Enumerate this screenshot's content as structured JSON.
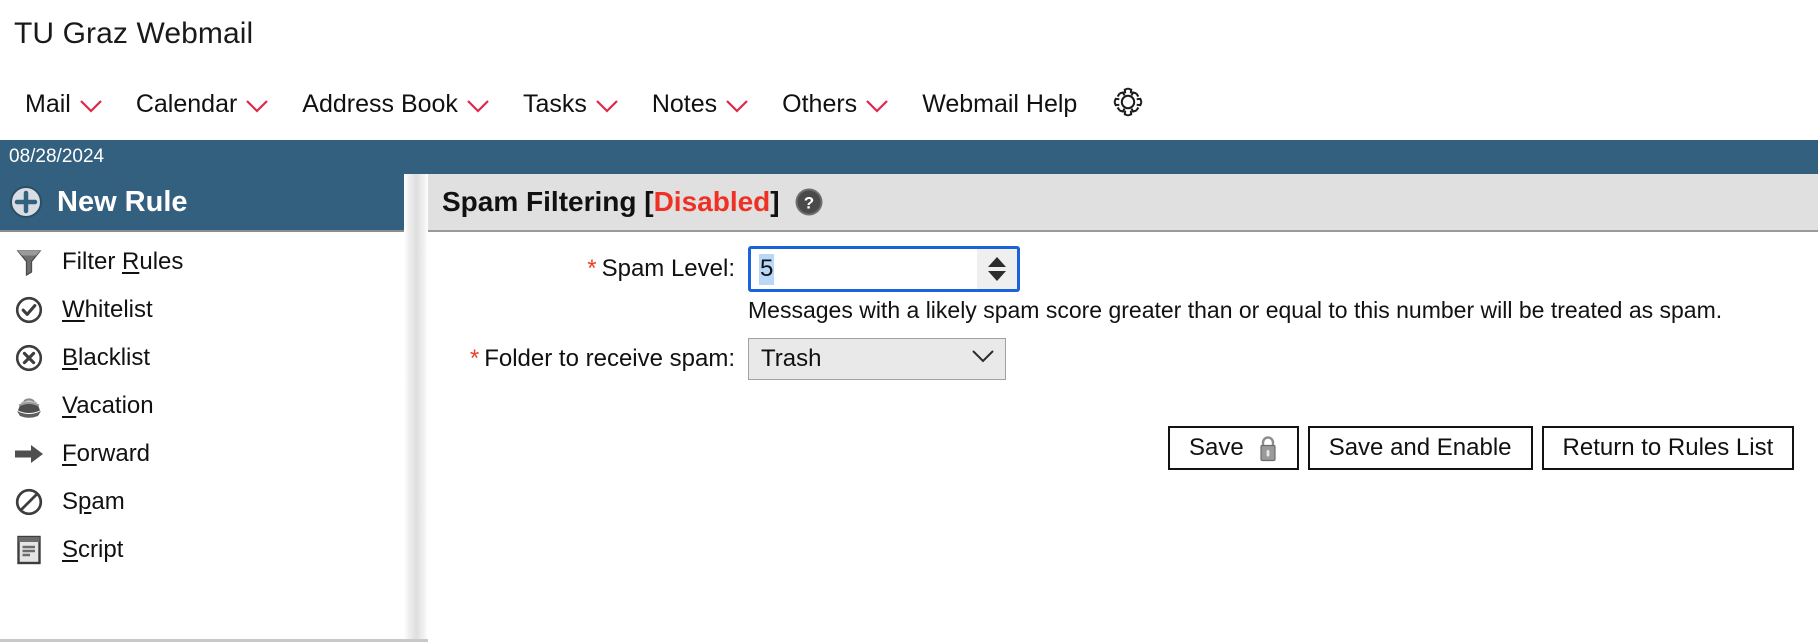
{
  "brand": {
    "title": "TU Graz Webmail"
  },
  "nav": {
    "items": [
      {
        "label": "Mail",
        "has_caret": true,
        "icon": "chevron-down-icon"
      },
      {
        "label": "Calendar",
        "has_caret": true,
        "icon": "chevron-down-icon"
      },
      {
        "label": "Address Book",
        "has_caret": true,
        "icon": "chevron-down-icon"
      },
      {
        "label": "Tasks",
        "has_caret": true,
        "icon": "chevron-down-icon"
      },
      {
        "label": "Notes",
        "has_caret": true,
        "icon": "chevron-down-icon"
      },
      {
        "label": "Others",
        "has_caret": true,
        "icon": "chevron-down-icon"
      },
      {
        "label": "Webmail Help",
        "has_caret": false,
        "icon": ""
      }
    ],
    "settings_icon": "gear-icon",
    "caret_color": "#e0274b"
  },
  "datebar": {
    "date": "08/28/2024",
    "background": "#34607f"
  },
  "sidebar": {
    "new_rule": {
      "label": "New Rule",
      "icon": "plus-circle-icon"
    },
    "items": [
      {
        "label": "Filter Rules",
        "pre": "Filter ",
        "accel": "R",
        "post": "ules",
        "icon": "funnel-icon"
      },
      {
        "label": "Whitelist",
        "pre": "",
        "accel": "W",
        "post": "hitelist",
        "icon": "check-circle-icon"
      },
      {
        "label": "Blacklist",
        "pre": "",
        "accel": "B",
        "post": "lacklist",
        "icon": "x-circle-icon"
      },
      {
        "label": "Vacation",
        "pre": "",
        "accel": "V",
        "post": "acation",
        "icon": "beach-icon"
      },
      {
        "label": "Forward",
        "pre": "",
        "accel": "F",
        "post": "orward",
        "icon": "arrow-right-icon"
      },
      {
        "label": "Spam",
        "pre": "S",
        "accel": "p",
        "post": "am",
        "icon": "no-entry-icon"
      },
      {
        "label": "Script",
        "pre": "",
        "accel": "S",
        "post": "cript",
        "icon": "script-icon"
      }
    ]
  },
  "content": {
    "title_main": "Spam Filtering [",
    "title_status": "Disabled",
    "title_tail": "]",
    "help_icon": "help-circle-icon",
    "status_color": "#ee3124",
    "form": {
      "spam_level": {
        "required_marker": "*",
        "label": "Spam Level:",
        "value": "5",
        "hint": "Messages with a likely spam score greater than or equal to this number will be treated as spam.",
        "spinner_up_icon": "triangle-up-icon",
        "spinner_down_icon": "triangle-down-icon"
      },
      "spam_folder": {
        "required_marker": "*",
        "label": "Folder to receive spam:",
        "value": "Trash",
        "caret_icon": "chevron-down-icon"
      }
    },
    "buttons": [
      {
        "label": "Save",
        "icon": "lock-icon"
      },
      {
        "label": "Save and Enable",
        "icon": ""
      },
      {
        "label": "Return to Rules List",
        "icon": ""
      }
    ]
  }
}
